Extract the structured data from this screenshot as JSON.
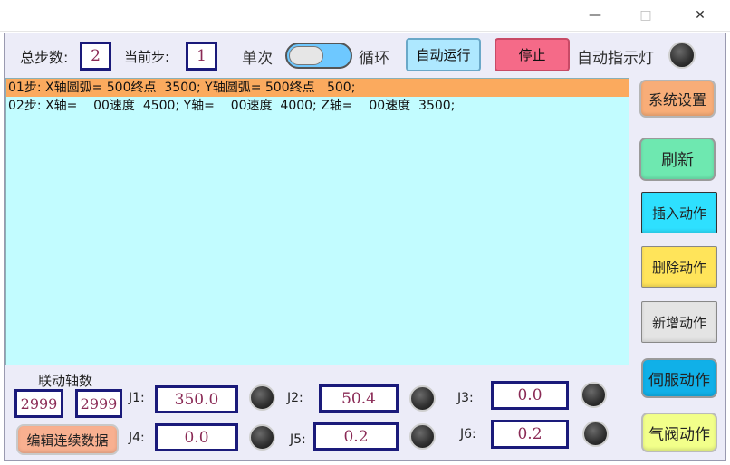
{
  "window": {
    "minimize": "—",
    "maximize": "□",
    "close": "✕"
  },
  "header": {
    "total_steps_label": "总步数:",
    "total_steps_value": "2",
    "current_step_label": "当前步:",
    "current_step_value": "1",
    "single_label": "单次",
    "loop_label": "循环",
    "auto_run_button": "自动运行",
    "stop_button": "停止",
    "auto_lamp_label": "自动指示灯"
  },
  "steps": [
    "01步: X轴圆弧= 500终点  3500; Y轴圆弧= 500终点   500;",
    "02步: X轴=    00速度  4500; Y轴=    00速度  4000; Z轴=    00速度  3500;"
  ],
  "sidebar": {
    "system_settings": "系统设置",
    "refresh": "刷新",
    "insert_action": "插入动作",
    "delete_action": "删除动作",
    "add_action": "新增动作",
    "servo_action": "伺服动作",
    "valve_action": "气阀动作"
  },
  "bottom": {
    "linked_axis_label": "联动轴数",
    "linked_value_1": "2999",
    "linked_value_2": "2999",
    "edit_continuous_button": "编辑连续数据",
    "joints": [
      {
        "label": "J1:",
        "value": "350.0"
      },
      {
        "label": "J2:",
        "value": "50.4"
      },
      {
        "label": "J3:",
        "value": "0.0"
      },
      {
        "label": "J4:",
        "value": "0.0"
      },
      {
        "label": "J5:",
        "value": "0.2"
      },
      {
        "label": "J6:",
        "value": "0.2"
      }
    ]
  },
  "colors": {
    "selected_row": "#fbaa5e",
    "list_bg": "#c2fcff",
    "auto_run_bg": "#aee8ff",
    "stop_bg": "#f56a88",
    "system_settings_bg": "#f8ad78",
    "refresh_bg": "#6ee8b0",
    "insert_bg": "#2ee0ff",
    "delete_bg": "#ffe45a",
    "add_bg": "#e4e4e4",
    "servo_bg": "#10b0e8",
    "valve_bg": "#f2ff8a",
    "edit_bg": "#f8b090"
  }
}
